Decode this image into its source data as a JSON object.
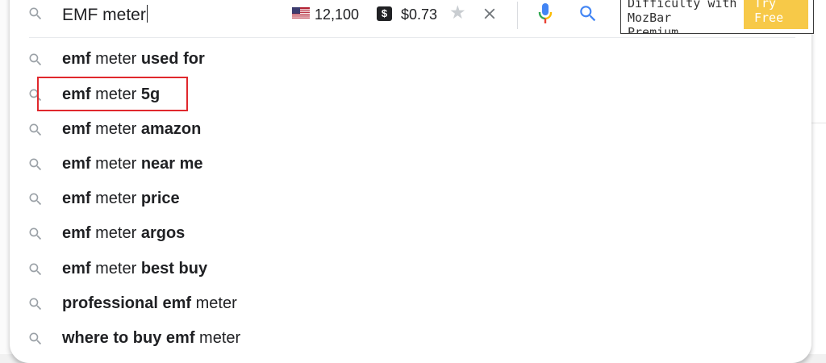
{
  "search": {
    "query": "EMF meter",
    "volume": "12,100",
    "dollar_badge": "$",
    "cpc": "$0.73"
  },
  "moz": {
    "text": "Difficulty with\nMozBar\nPremium",
    "button": "Try\nFree"
  },
  "suggestions": [
    {
      "parts": [
        {
          "t": "emf",
          "b": true
        },
        {
          "t": " meter ",
          "b": false
        },
        {
          "t": "used for",
          "b": true
        }
      ]
    },
    {
      "parts": [
        {
          "t": "emf",
          "b": true
        },
        {
          "t": " meter ",
          "b": false
        },
        {
          "t": "5g",
          "b": true
        }
      ]
    },
    {
      "parts": [
        {
          "t": "emf",
          "b": true
        },
        {
          "t": " meter ",
          "b": false
        },
        {
          "t": "amazon",
          "b": true
        }
      ]
    },
    {
      "parts": [
        {
          "t": "emf",
          "b": true
        },
        {
          "t": " meter ",
          "b": false
        },
        {
          "t": "near me",
          "b": true
        }
      ]
    },
    {
      "parts": [
        {
          "t": "emf",
          "b": true
        },
        {
          "t": " meter ",
          "b": false
        },
        {
          "t": "price",
          "b": true
        }
      ]
    },
    {
      "parts": [
        {
          "t": "emf",
          "b": true
        },
        {
          "t": " meter ",
          "b": false
        },
        {
          "t": "argos",
          "b": true
        }
      ]
    },
    {
      "parts": [
        {
          "t": "emf",
          "b": true
        },
        {
          "t": " meter ",
          "b": false
        },
        {
          "t": "best buy",
          "b": true
        }
      ]
    },
    {
      "parts": [
        {
          "t": "professional emf",
          "b": true
        },
        {
          "t": " meter",
          "b": false
        }
      ]
    },
    {
      "parts": [
        {
          "t": "where to buy emf",
          "b": true
        },
        {
          "t": " meter",
          "b": false
        }
      ]
    }
  ],
  "highlighted_suggestion": 1,
  "colors": {
    "highlight": "#e0282d",
    "moz_button": "#f7c948",
    "mic_blue": "#4285f4",
    "mic_red": "#ea4335",
    "mic_green": "#34a853",
    "mic_yellow": "#fbbc05"
  },
  "icons": {
    "search": "search-icon",
    "flag": "us-flag-icon",
    "star": "star-icon",
    "clear": "close-icon",
    "mic": "microphone-icon",
    "submit": "search-icon"
  }
}
